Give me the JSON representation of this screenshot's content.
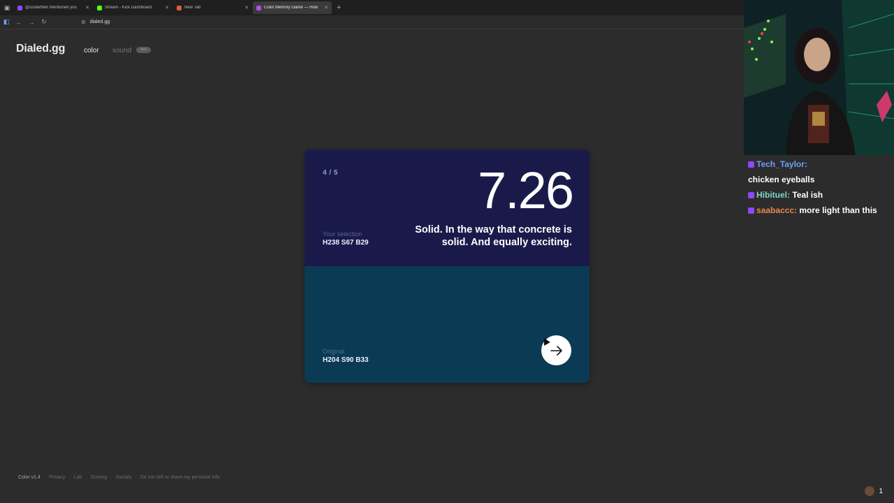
{
  "browser": {
    "tabs": [
      {
        "title": "@coolwhitet mentioned you",
        "favicon": "#9146ff",
        "active": false
      },
      {
        "title": "Stream - Kick Dashboard",
        "favicon": "#53fc18",
        "active": false
      },
      {
        "title": "New Tab",
        "favicon": "#e05a3a",
        "active": false
      },
      {
        "title": "Color Memory Game — How",
        "favicon": "#b050e0",
        "active": true
      }
    ],
    "url": "dialed.gg"
  },
  "site": {
    "logo": "Dialed.gg",
    "nav": {
      "color": "color",
      "sound": "sound",
      "badge": "new"
    }
  },
  "card": {
    "progress": "4 / 5",
    "score": "7.26",
    "comment": "Solid. In the way that concrete is solid. And equally exciting.",
    "selection_label": "Your selection",
    "selection_value": "H238 S67 B29",
    "original_label": "Original",
    "original_value": "H204 S90 B33",
    "selection_color": "#1a1a4a",
    "original_color": "#0b3b54"
  },
  "footer": {
    "version": "Color v1.4",
    "links": [
      "Privacy",
      "Lab",
      "Scoring",
      "Socials",
      "Do not sell or share my personal info"
    ]
  },
  "stream": {
    "chat": [
      {
        "user": "Tech_Taylor:",
        "color": "#6ea0ff",
        "message": ""
      },
      {
        "user": "",
        "color": "#ffffff",
        "message": "chicken eyeballs"
      },
      {
        "user": "Hibituel:",
        "color": "#7fd6c8",
        "message": "Teal ish"
      },
      {
        "user": "saabaccc:",
        "color": "#e8864f",
        "message": "more light than this"
      }
    ],
    "viewer_count": "1"
  }
}
